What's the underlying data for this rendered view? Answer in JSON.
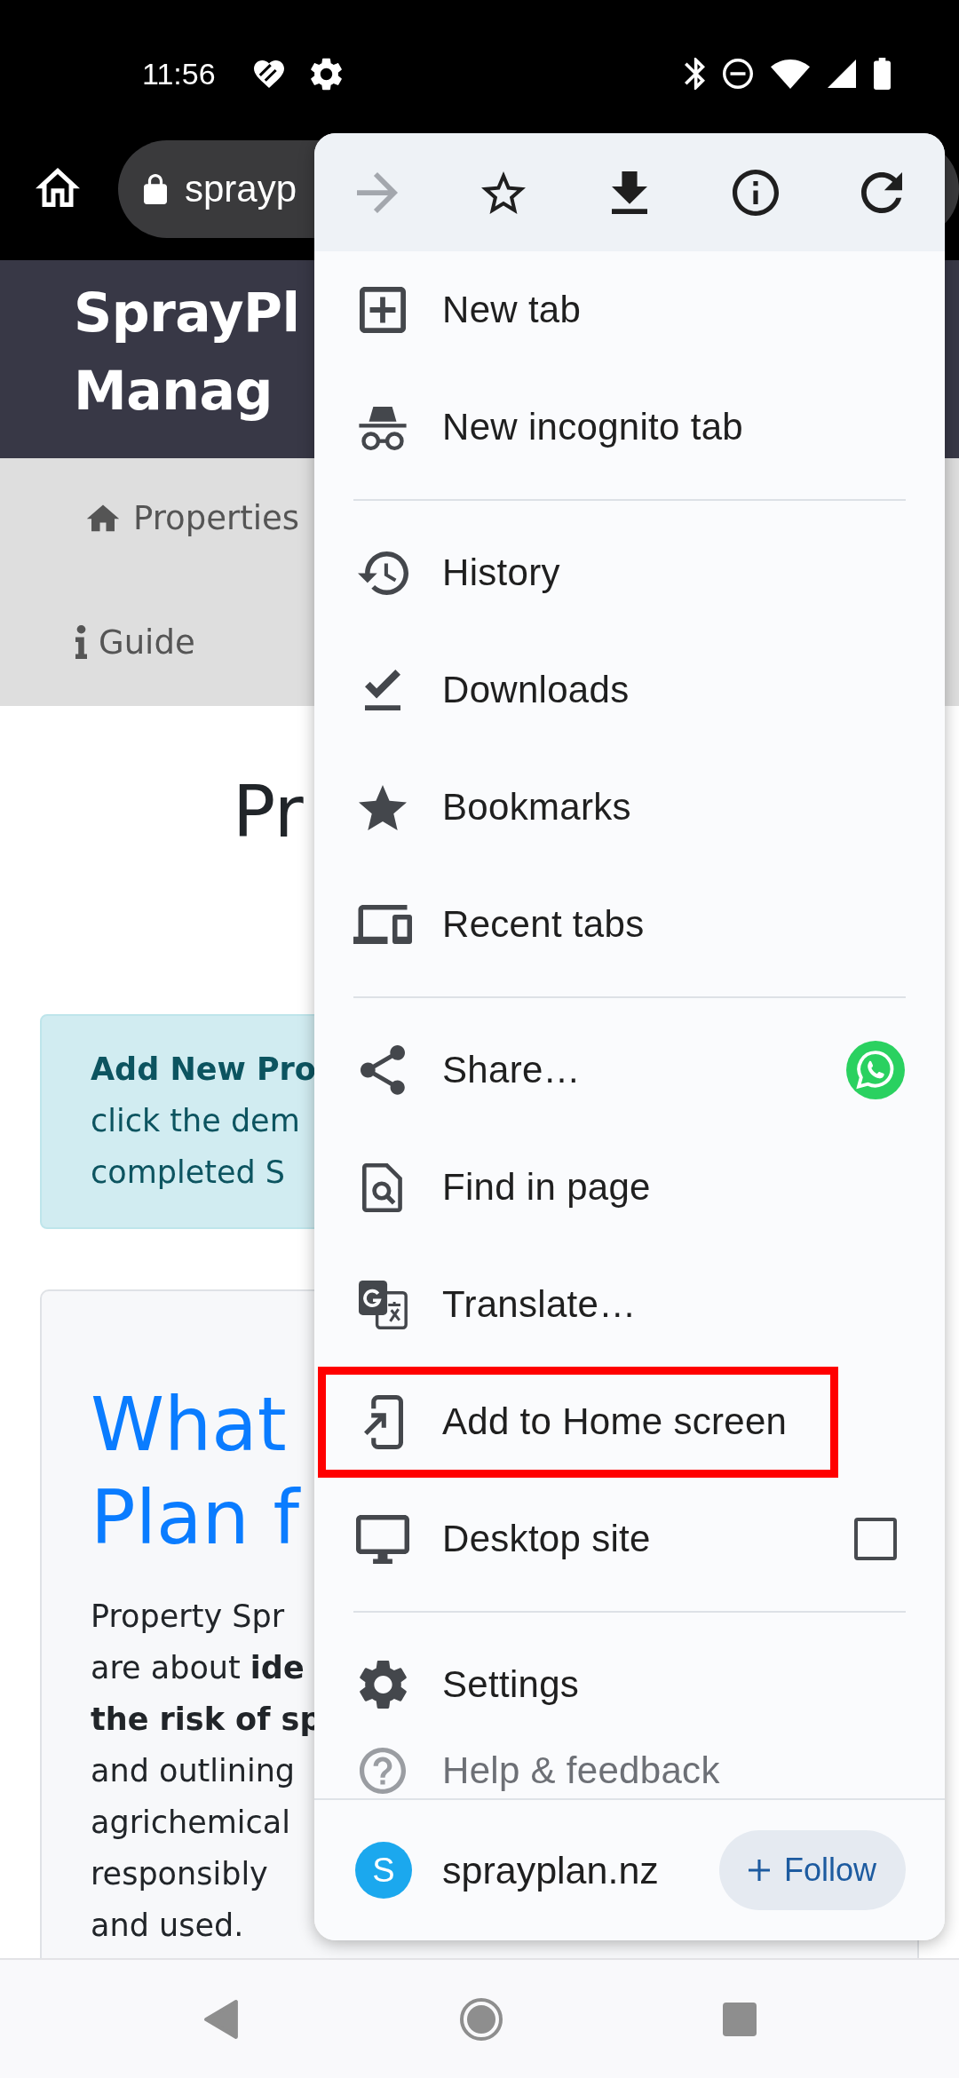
{
  "status_bar": {
    "time": "11:56"
  },
  "browser_toolbar": {
    "url": "sprayp"
  },
  "page": {
    "header": {
      "title_lines": [
        "SprayPl",
        "Manag"
      ]
    },
    "nav": [
      {
        "label": "Properties"
      },
      {
        "label": "Guide"
      }
    ],
    "heading": "Pr",
    "alert": {
      "lines": [
        "**Add New Pro**",
        "click the dem",
        "completed S"
      ]
    },
    "card": {
      "title_lines": [
        "What",
        "Plan f"
      ],
      "paragraph_lines": [
        "Property Spr",
        "are about **ide**",
        "**the risk of sp**",
        "and outlining",
        "agrichemical",
        "responsibly",
        "and used."
      ]
    }
  },
  "menu": {
    "toolbar": [
      {
        "disabled": true
      },
      {
        "disabled": false
      },
      {
        "disabled": false
      },
      {
        "disabled": false
      },
      {
        "disabled": false
      }
    ],
    "groups": [
      {
        "items": [
          {
            "label": "New tab",
            "kind": "plain",
            "highlighted": false
          },
          {
            "label": "New incognito tab",
            "kind": "plain",
            "highlighted": false
          }
        ]
      },
      {
        "items": [
          {
            "label": "History",
            "kind": "plain",
            "highlighted": false
          },
          {
            "label": "Downloads",
            "kind": "plain",
            "highlighted": false
          },
          {
            "label": "Bookmarks",
            "kind": "plain",
            "highlighted": false
          },
          {
            "label": "Recent tabs",
            "kind": "plain",
            "highlighted": false
          }
        ]
      },
      {
        "items": [
          {
            "label": "Share…",
            "kind": "share",
            "highlighted": false
          },
          {
            "label": "Find in page",
            "kind": "plain",
            "highlighted": false
          },
          {
            "label": "Translate…",
            "kind": "plain",
            "highlighted": false
          },
          {
            "label": "Add to Home screen",
            "kind": "plain",
            "highlighted": true
          },
          {
            "label": "Desktop site",
            "kind": "checkbox",
            "checked": false,
            "highlighted": false
          }
        ]
      },
      {
        "items": [
          {
            "label": "Settings",
            "kind": "plain",
            "highlighted": false
          },
          {
            "label": "Help & feedback",
            "kind": "plain",
            "highlighted": false
          }
        ]
      }
    ],
    "footer": {
      "avatar_letter": "S",
      "site": "sprayplan.nz",
      "follow": "Follow"
    }
  }
}
